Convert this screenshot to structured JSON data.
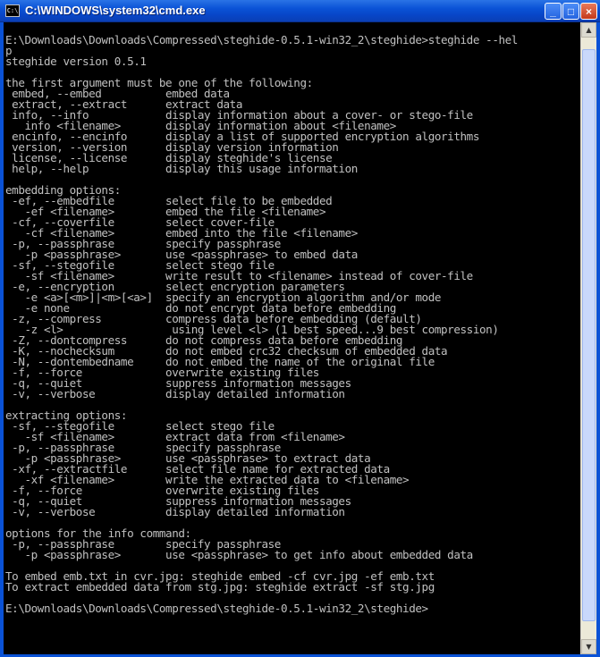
{
  "window": {
    "title": "C:\\WINDOWS\\system32\\cmd.exe",
    "icon_label": "C:\\",
    "minimize_label": "_",
    "maximize_label": "□",
    "close_label": "×"
  },
  "scrollbar": {
    "up_arrow": "▲",
    "down_arrow": "▼"
  },
  "console": {
    "text": "E:\\Downloads\\Downloads\\Compressed\\steghide-0.5.1-win32_2\\steghide>steghide --hel\np\nsteghide version 0.5.1\n\nthe first argument must be one of the following:\n embed, --embed          embed data\n extract, --extract      extract data\n info, --info            display information about a cover- or stego-file\n   info <filename>       display information about <filename>\n encinfo, --encinfo      display a list of supported encryption algorithms\n version, --version      display version information\n license, --license      display steghide's license\n help, --help            display this usage information\n\nembedding options:\n -ef, --embedfile        select file to be embedded\n   -ef <filename>        embed the file <filename>\n -cf, --coverfile        select cover-file\n   -cf <filename>        embed into the file <filename>\n -p, --passphrase        specify passphrase\n   -p <passphrase>       use <passphrase> to embed data\n -sf, --stegofile        select stego file\n   -sf <filename>        write result to <filename> instead of cover-file\n -e, --encryption        select encryption parameters\n   -e <a>[<m>]|<m>[<a>]  specify an encryption algorithm and/or mode\n   -e none               do not encrypt data before embedding\n -z, --compress          compress data before embedding (default)\n   -z <l>                 using level <l> (1 best speed...9 best compression)\n -Z, --dontcompress      do not compress data before embedding\n -K, --nochecksum        do not embed crc32 checksum of embedded data\n -N, --dontembedname     do not embed the name of the original file\n -f, --force             overwrite existing files\n -q, --quiet             suppress information messages\n -v, --verbose           display detailed information\n\nextracting options:\n -sf, --stegofile        select stego file\n   -sf <filename>        extract data from <filename>\n -p, --passphrase        specify passphrase\n   -p <passphrase>       use <passphrase> to extract data\n -xf, --extractfile      select file name for extracted data\n   -xf <filename>        write the extracted data to <filename>\n -f, --force             overwrite existing files\n -q, --quiet             suppress information messages\n -v, --verbose           display detailed information\n\noptions for the info command:\n -p, --passphrase        specify passphrase\n   -p <passphrase>       use <passphrase> to get info about embedded data\n\nTo embed emb.txt in cvr.jpg: steghide embed -cf cvr.jpg -ef emb.txt\nTo extract embedded data from stg.jpg: steghide extract -sf stg.jpg\n\nE:\\Downloads\\Downloads\\Compressed\\steghide-0.5.1-win32_2\\steghide>"
  }
}
